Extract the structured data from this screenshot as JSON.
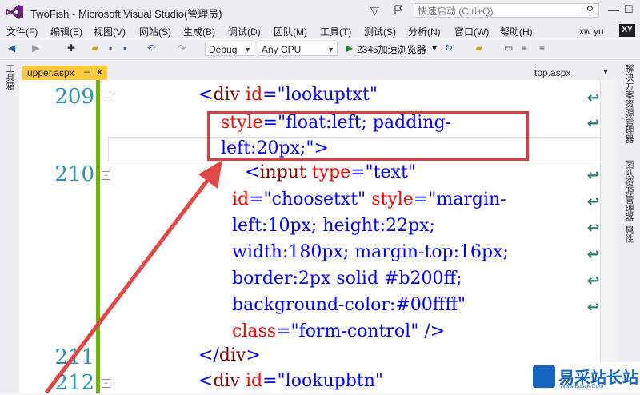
{
  "window": {
    "title": "TwoFish - Microsoft Visual Studio(管理员)",
    "quick_launch_placeholder": "快速启动 (Ctrl+Q)"
  },
  "menu": [
    "文件(F)",
    "编辑(E)",
    "视图(V)",
    "网站(S)",
    "生成(B)",
    "调试(D)",
    "团队(M)",
    "工具(T)",
    "测试(S)",
    "分析(N)",
    "窗口(W)",
    "帮助(H)"
  ],
  "user": {
    "name": "xw yu",
    "initials": "XY"
  },
  "toolbar": {
    "config": "Debug",
    "platform": "Any CPU",
    "browser": "2345加速浏览器"
  },
  "side_tabs": {
    "left": "工具箱",
    "right": [
      "解决方案资源管理器",
      "团队资源管理器",
      "属性"
    ]
  },
  "tabs": {
    "active": "upper.aspx",
    "other": "top.aspx"
  },
  "editor": {
    "line_numbers": {
      "l209": "209",
      "l210": "210",
      "l211": "211",
      "l212": "212"
    }
  },
  "watermark": {
    "text": "易采站长站",
    "subtext": "Www.Easck.Com"
  },
  "colors": {
    "accent": "#ffc83d",
    "line_number": "#2b91af",
    "highlight": "#d94040"
  }
}
